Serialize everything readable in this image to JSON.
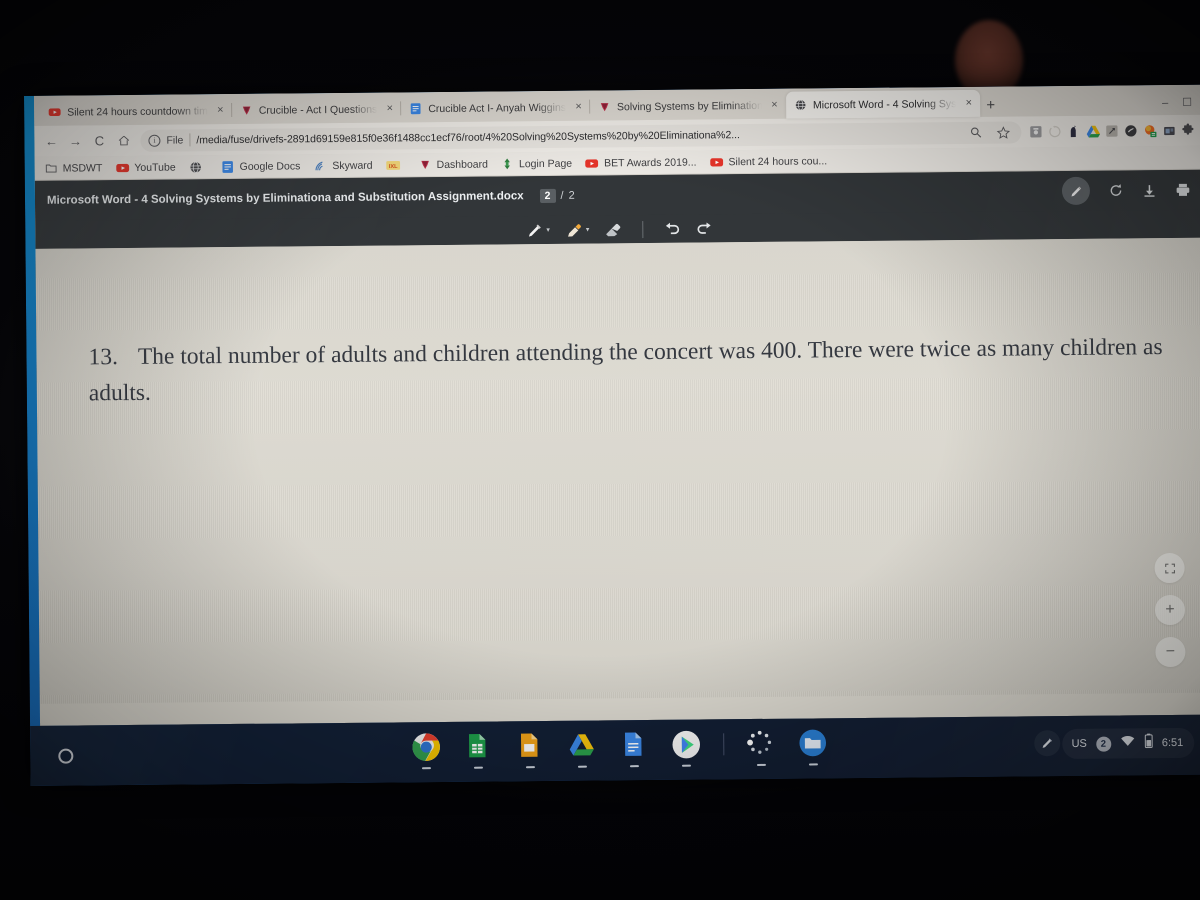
{
  "browser": {
    "tabs": [
      {
        "title": "Silent 24 hours countdown tim",
        "favicon": "youtube-icon",
        "active": false,
        "close_label": "×"
      },
      {
        "title": "Crucible - Act I Questions",
        "favicon": "quizlet-icon",
        "active": false,
        "close_label": "×"
      },
      {
        "title": "Crucible Act I- Anyah Wiggins",
        "favicon": "google-docs-icon",
        "active": false,
        "close_label": "×"
      },
      {
        "title": "Solving Systems by Elimination",
        "favicon": "quizlet-icon",
        "active": false,
        "close_label": "×"
      },
      {
        "title": "Microsoft Word - 4 Solving Sys",
        "favicon": "globe-icon",
        "active": true,
        "close_label": "×"
      }
    ],
    "new_tab_label": "+",
    "window_controls": {
      "minimize": "–",
      "maximize": "☐"
    },
    "nav": {
      "back": "←",
      "forward": "→",
      "reload": "C",
      "home": "⌂"
    },
    "omnibox": {
      "scheme_label": "File",
      "info_glyph": "i",
      "url": "/media/fuse/drivefs-2891d69159e815f0e36f1488cc1ecf76/root/4%20Solving%20Systems%20by%20Eliminationa%2...",
      "actions": [
        "search-icon",
        "bookmark-star-icon"
      ]
    },
    "extensions": [
      "screenshot-extension-icon",
      "loading-circle-icon",
      "alpaca-extension-icon",
      "google-drive-icon",
      "grammarly-extension-icon",
      "dark-circle-extension-icon",
      "color-extension-icon",
      "blue-box-extension-icon",
      "extensions-puzzle-icon"
    ],
    "bookmarks": [
      {
        "label": "MSDWT",
        "icon": "folder-icon"
      },
      {
        "label": "YouTube",
        "icon": "youtube-icon"
      },
      {
        "label": "",
        "icon": "globe-icon"
      },
      {
        "label": "Google Docs",
        "icon": "google-docs-icon"
      },
      {
        "label": "Skyward",
        "icon": "skyward-icon"
      },
      {
        "label": "",
        "icon": "ixl-icon"
      },
      {
        "label": "Dashboard",
        "icon": "quizlet-icon"
      },
      {
        "label": "Login Page",
        "icon": "login-arrows-icon"
      },
      {
        "label": "BET Awards 2019...",
        "icon": "youtube-icon"
      },
      {
        "label": "Silent 24 hours cou...",
        "icon": "youtube-icon"
      }
    ]
  },
  "pdf_viewer": {
    "document_title": "Microsoft Word - 4 Solving Systems by Eliminationa and Substitution Assignment.docx",
    "page_current": "2",
    "page_separator": "/",
    "page_total": "2",
    "top_actions": [
      "annotate-pen-icon",
      "rotate-icon",
      "download-icon",
      "print-icon"
    ],
    "annotation_tools": [
      {
        "name": "pen-tool",
        "caret": "▾"
      },
      {
        "name": "highlighter-tool",
        "caret": "▾"
      },
      {
        "name": "eraser-tool",
        "caret": ""
      },
      {
        "name": "undo-tool",
        "caret": ""
      },
      {
        "name": "redo-tool",
        "caret": ""
      }
    ],
    "zoom_controls": [
      {
        "name": "fit-to-page-button",
        "glyph": "⤡⤢"
      },
      {
        "name": "zoom-in-button",
        "glyph": "+"
      },
      {
        "name": "zoom-out-button",
        "glyph": "−"
      }
    ]
  },
  "document": {
    "question_number": "13.",
    "question_text": "The total number of adults and children attending the concert was 400.  There were twice as many children as adults."
  },
  "shelf": {
    "launcher_name": "launcher-button",
    "apps": [
      "google-chrome-icon",
      "google-sheets-icon",
      "google-slides-icon",
      "google-drive-icon",
      "google-docs-icon",
      "google-play-store-icon",
      "loading-spinner-icon",
      "files-app-icon"
    ],
    "tray": {
      "stylus_label": "stylus-icon",
      "keyboard_layout": "US",
      "notification_count": "2",
      "wifi": "wifi-icon",
      "battery": "battery-icon",
      "time": "6:51"
    }
  },
  "colors": {
    "chrome_toolbar": "#f1eee9",
    "pdf_chrome": "#323639",
    "page_paper": "#dcd9d0",
    "shelf": "#121c2e",
    "accent_blue": "#1565b8"
  }
}
